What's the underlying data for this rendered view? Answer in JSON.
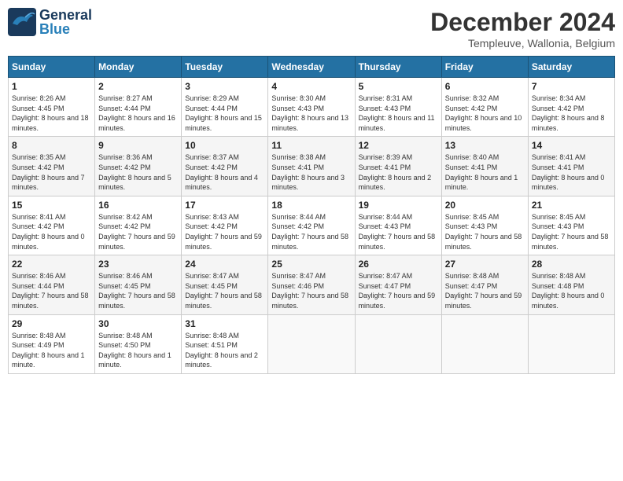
{
  "header": {
    "logo_general": "General",
    "logo_blue": "Blue",
    "month_title": "December 2024",
    "location": "Templeuve, Wallonia, Belgium"
  },
  "calendar": {
    "days_of_week": [
      "Sunday",
      "Monday",
      "Tuesday",
      "Wednesday",
      "Thursday",
      "Friday",
      "Saturday"
    ],
    "weeks": [
      [
        {
          "day": "1",
          "sunrise": "Sunrise: 8:26 AM",
          "sunset": "Sunset: 4:45 PM",
          "daylight": "Daylight: 8 hours and 18 minutes."
        },
        {
          "day": "2",
          "sunrise": "Sunrise: 8:27 AM",
          "sunset": "Sunset: 4:44 PM",
          "daylight": "Daylight: 8 hours and 16 minutes."
        },
        {
          "day": "3",
          "sunrise": "Sunrise: 8:29 AM",
          "sunset": "Sunset: 4:44 PM",
          "daylight": "Daylight: 8 hours and 15 minutes."
        },
        {
          "day": "4",
          "sunrise": "Sunrise: 8:30 AM",
          "sunset": "Sunset: 4:43 PM",
          "daylight": "Daylight: 8 hours and 13 minutes."
        },
        {
          "day": "5",
          "sunrise": "Sunrise: 8:31 AM",
          "sunset": "Sunset: 4:43 PM",
          "daylight": "Daylight: 8 hours and 11 minutes."
        },
        {
          "day": "6",
          "sunrise": "Sunrise: 8:32 AM",
          "sunset": "Sunset: 4:42 PM",
          "daylight": "Daylight: 8 hours and 10 minutes."
        },
        {
          "day": "7",
          "sunrise": "Sunrise: 8:34 AM",
          "sunset": "Sunset: 4:42 PM",
          "daylight": "Daylight: 8 hours and 8 minutes."
        }
      ],
      [
        {
          "day": "8",
          "sunrise": "Sunrise: 8:35 AM",
          "sunset": "Sunset: 4:42 PM",
          "daylight": "Daylight: 8 hours and 7 minutes."
        },
        {
          "day": "9",
          "sunrise": "Sunrise: 8:36 AM",
          "sunset": "Sunset: 4:42 PM",
          "daylight": "Daylight: 8 hours and 5 minutes."
        },
        {
          "day": "10",
          "sunrise": "Sunrise: 8:37 AM",
          "sunset": "Sunset: 4:42 PM",
          "daylight": "Daylight: 8 hours and 4 minutes."
        },
        {
          "day": "11",
          "sunrise": "Sunrise: 8:38 AM",
          "sunset": "Sunset: 4:41 PM",
          "daylight": "Daylight: 8 hours and 3 minutes."
        },
        {
          "day": "12",
          "sunrise": "Sunrise: 8:39 AM",
          "sunset": "Sunset: 4:41 PM",
          "daylight": "Daylight: 8 hours and 2 minutes."
        },
        {
          "day": "13",
          "sunrise": "Sunrise: 8:40 AM",
          "sunset": "Sunset: 4:41 PM",
          "daylight": "Daylight: 8 hours and 1 minute."
        },
        {
          "day": "14",
          "sunrise": "Sunrise: 8:41 AM",
          "sunset": "Sunset: 4:41 PM",
          "daylight": "Daylight: 8 hours and 0 minutes."
        }
      ],
      [
        {
          "day": "15",
          "sunrise": "Sunrise: 8:41 AM",
          "sunset": "Sunset: 4:42 PM",
          "daylight": "Daylight: 8 hours and 0 minutes."
        },
        {
          "day": "16",
          "sunrise": "Sunrise: 8:42 AM",
          "sunset": "Sunset: 4:42 PM",
          "daylight": "Daylight: 7 hours and 59 minutes."
        },
        {
          "day": "17",
          "sunrise": "Sunrise: 8:43 AM",
          "sunset": "Sunset: 4:42 PM",
          "daylight": "Daylight: 7 hours and 59 minutes."
        },
        {
          "day": "18",
          "sunrise": "Sunrise: 8:44 AM",
          "sunset": "Sunset: 4:42 PM",
          "daylight": "Daylight: 7 hours and 58 minutes."
        },
        {
          "day": "19",
          "sunrise": "Sunrise: 8:44 AM",
          "sunset": "Sunset: 4:43 PM",
          "daylight": "Daylight: 7 hours and 58 minutes."
        },
        {
          "day": "20",
          "sunrise": "Sunrise: 8:45 AM",
          "sunset": "Sunset: 4:43 PM",
          "daylight": "Daylight: 7 hours and 58 minutes."
        },
        {
          "day": "21",
          "sunrise": "Sunrise: 8:45 AM",
          "sunset": "Sunset: 4:43 PM",
          "daylight": "Daylight: 7 hours and 58 minutes."
        }
      ],
      [
        {
          "day": "22",
          "sunrise": "Sunrise: 8:46 AM",
          "sunset": "Sunset: 4:44 PM",
          "daylight": "Daylight: 7 hours and 58 minutes."
        },
        {
          "day": "23",
          "sunrise": "Sunrise: 8:46 AM",
          "sunset": "Sunset: 4:45 PM",
          "daylight": "Daylight: 7 hours and 58 minutes."
        },
        {
          "day": "24",
          "sunrise": "Sunrise: 8:47 AM",
          "sunset": "Sunset: 4:45 PM",
          "daylight": "Daylight: 7 hours and 58 minutes."
        },
        {
          "day": "25",
          "sunrise": "Sunrise: 8:47 AM",
          "sunset": "Sunset: 4:46 PM",
          "daylight": "Daylight: 7 hours and 58 minutes."
        },
        {
          "day": "26",
          "sunrise": "Sunrise: 8:47 AM",
          "sunset": "Sunset: 4:47 PM",
          "daylight": "Daylight: 7 hours and 59 minutes."
        },
        {
          "day": "27",
          "sunrise": "Sunrise: 8:48 AM",
          "sunset": "Sunset: 4:47 PM",
          "daylight": "Daylight: 7 hours and 59 minutes."
        },
        {
          "day": "28",
          "sunrise": "Sunrise: 8:48 AM",
          "sunset": "Sunset: 4:48 PM",
          "daylight": "Daylight: 8 hours and 0 minutes."
        }
      ],
      [
        {
          "day": "29",
          "sunrise": "Sunrise: 8:48 AM",
          "sunset": "Sunset: 4:49 PM",
          "daylight": "Daylight: 8 hours and 1 minute."
        },
        {
          "day": "30",
          "sunrise": "Sunrise: 8:48 AM",
          "sunset": "Sunset: 4:50 PM",
          "daylight": "Daylight: 8 hours and 1 minute."
        },
        {
          "day": "31",
          "sunrise": "Sunrise: 8:48 AM",
          "sunset": "Sunset: 4:51 PM",
          "daylight": "Daylight: 8 hours and 2 minutes."
        },
        null,
        null,
        null,
        null
      ]
    ]
  }
}
